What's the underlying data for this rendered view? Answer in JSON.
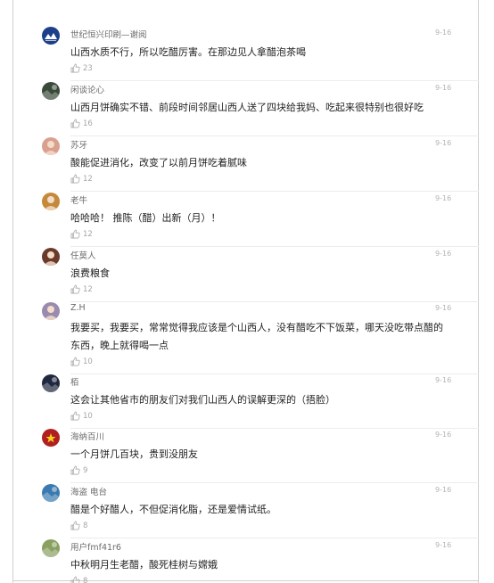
{
  "comments": [
    {
      "user": "世纪恒兴印刷—谢阅",
      "date": "9-16",
      "text": "山西水质不行，所以吃醋厉害。在那边见人拿醋泡茶喝",
      "likes": "23",
      "avatar_color": "#1e3f8a",
      "avatar_icon": "mountain-logo"
    },
    {
      "user": "闲谈论心",
      "date": "9-16",
      "text": "山西月饼确实不错、前段时间邻居山西人送了四块给我妈、吃起来很特别也很好吃",
      "likes": "16",
      "avatar_color": "#3a4a3a",
      "avatar_icon": "photo"
    },
    {
      "user": "苏牙",
      "date": "9-16",
      "text": "酸能促进消化，改变了以前月饼吃着腻味",
      "likes": "12",
      "avatar_color": "#d9a090",
      "avatar_icon": "portrait"
    },
    {
      "user": "老牛",
      "date": "9-16",
      "text": "哈哈哈！ 推陈（醋）出新（月）！",
      "likes": "12",
      "avatar_color": "#c48a3a",
      "avatar_icon": "portrait"
    },
    {
      "user": "任莫人",
      "date": "9-16",
      "text": "浪费粮食",
      "likes": "12",
      "avatar_color": "#6a3a2a",
      "avatar_icon": "portrait"
    },
    {
      "user": "Z.H",
      "date": "9-16",
      "text": "我要买，我要买，常常觉得我应该是个山西人，没有醋吃不下饭菜，哪天没吃带点醋的东西，晚上就得喝一点",
      "likes": "10",
      "avatar_color": "#9a8ab0",
      "avatar_icon": "portrait"
    },
    {
      "user": "栢",
      "date": "9-16",
      "text": "这会让其他省市的朋友们对我们山西人的误解更深的（捂脸）",
      "likes": "10",
      "avatar_color": "#202840",
      "avatar_icon": "photo"
    },
    {
      "user": "海纳百川",
      "date": "9-16",
      "text": "一个月饼几百块，贵到没朋友",
      "likes": "9",
      "avatar_color": "#b02020",
      "avatar_icon": "flag"
    },
    {
      "user": "海盗 电台",
      "date": "9-16",
      "text": "醋是个好醋人，不但促消化脂，还是爱情试纸。",
      "likes": "8",
      "avatar_color": "#3a7ab0",
      "avatar_icon": "photo"
    },
    {
      "user": "用户fmf41r6",
      "date": "9-16",
      "text": "中秋明月生老醋，酸死桂树与嫦娥",
      "likes": "8",
      "avatar_color": "#8aa060",
      "avatar_icon": "photo"
    }
  ]
}
